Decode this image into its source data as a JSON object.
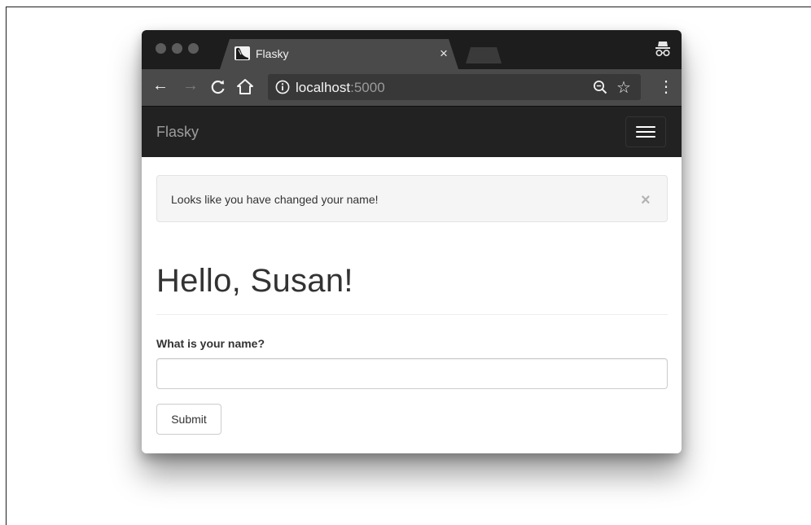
{
  "browser": {
    "tab": {
      "title": "Flasky",
      "close_glyph": "×",
      "favicon": "flask-favicon-icon"
    },
    "window_controls": [
      "close-dot",
      "minimize-dot",
      "zoom-dot"
    ],
    "toolbar": {
      "back_glyph": "←",
      "forward_glyph": "→",
      "reload_icon": "reload-icon",
      "home_icon": "home-icon",
      "url_host": "localhost",
      "url_port": ":5000",
      "zoom_icon": "zoom-out-icon",
      "bookmark_glyph": "☆",
      "menu_glyph": "⋮"
    },
    "incognito_icon": "incognito-icon"
  },
  "navbar": {
    "brand": "Flasky",
    "toggle_icon": "hamburger-menu-icon"
  },
  "alert": {
    "message": "Looks like you have changed your name!",
    "close_glyph": "×"
  },
  "page": {
    "heading": "Hello, Susan!"
  },
  "form": {
    "name_label": "What is your name?",
    "name_value": "",
    "submit_label": "Submit"
  },
  "colors": {
    "tabstrip": "#1d1d1d",
    "toolbar": "#4a4a4a",
    "navbar": "#222222",
    "brand_text": "#9d9d9d",
    "alert_bg": "#f5f5f5"
  }
}
